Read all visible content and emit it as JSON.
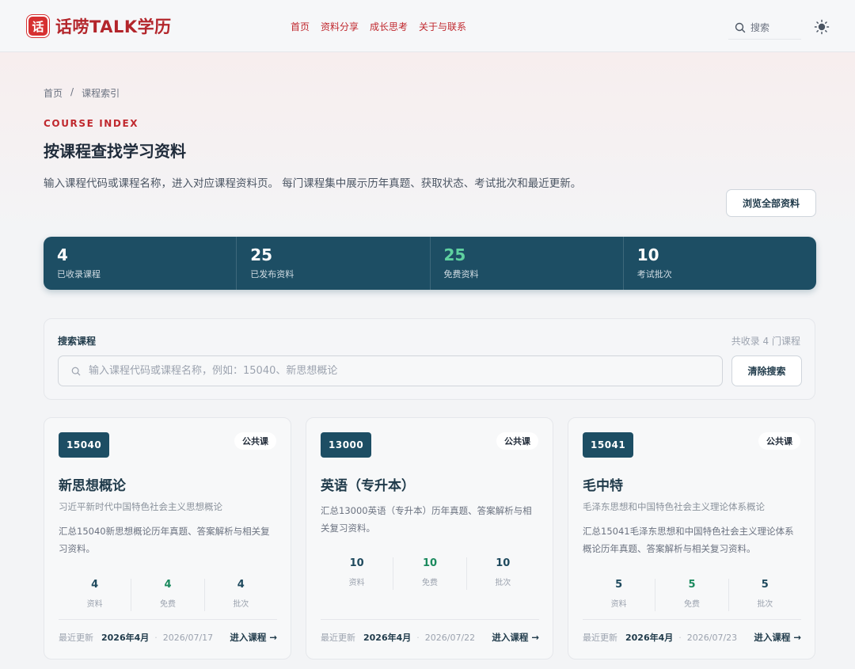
{
  "header": {
    "logo_mark": "话",
    "logo_text": "话唠TALK学历",
    "nav": [
      "首页",
      "资料分享",
      "成长思考",
      "关于与联系"
    ],
    "search_label": "搜索"
  },
  "breadcrumb": [
    "首页",
    "/",
    "课程索引"
  ],
  "hero": {
    "eyebrow": "COURSE INDEX",
    "title": "按课程查找学习资料",
    "lead": "输入课程代码或课程名称，进入对应课程资料页。 每门课程集中展示历年真题、获取状态、考试批次和最近更新。",
    "browse_button": "浏览全部资料"
  },
  "stats": [
    {
      "value": "4",
      "label": "已收录课程"
    },
    {
      "value": "25",
      "label": "已发布资料"
    },
    {
      "value": "25",
      "label": "免费资料"
    },
    {
      "value": "10",
      "label": "考试批次"
    }
  ],
  "search": {
    "title": "搜索课程",
    "count": "共收录 4 门课程",
    "placeholder": "输入课程代码或课程名称，例如：15040、新思想概论",
    "clear_button": "清除搜索"
  },
  "colors": {
    "accent": "#c0282e",
    "primary": "#1d4e64",
    "green": "#1b8a5e"
  },
  "courses": [
    {
      "code": "15040",
      "category": "公共课",
      "title": "新思想概论",
      "subtitle": "习近平新时代中国特色社会主义思想概论",
      "desc": "汇总15040新思想概论历年真题、答案解析与相关复习资料。",
      "stats": [
        {
          "n": "4",
          "l": "资料"
        },
        {
          "n": "4",
          "l": "免费"
        },
        {
          "n": "4",
          "l": "批次"
        }
      ],
      "updated_label": "最近更新",
      "updated": "2026年4月",
      "date": "2026/07/17",
      "enter": "进入课程 →"
    },
    {
      "code": "13000",
      "category": "公共课",
      "title": "英语（专升本）",
      "subtitle": "",
      "desc": "汇总13000英语（专升本）历年真题、答案解析与相关复习资料。",
      "stats": [
        {
          "n": "10",
          "l": "资料"
        },
        {
          "n": "10",
          "l": "免费"
        },
        {
          "n": "10",
          "l": "批次"
        }
      ],
      "updated_label": "最近更新",
      "updated": "2026年4月",
      "date": "2026/07/22",
      "enter": "进入课程 →"
    },
    {
      "code": "15041",
      "category": "公共课",
      "title": "毛中特",
      "subtitle": "毛泽东思想和中国特色社会主义理论体系概论",
      "desc": "汇总15041毛泽东思想和中国特色社会主义理论体系概论历年真题、答案解析与相关复习资料。",
      "stats": [
        {
          "n": "5",
          "l": "资料"
        },
        {
          "n": "5",
          "l": "免费"
        },
        {
          "n": "5",
          "l": "批次"
        }
      ],
      "updated_label": "最近更新",
      "updated": "2026年4月",
      "date": "2026/07/23",
      "enter": "进入课程 →"
    }
  ]
}
